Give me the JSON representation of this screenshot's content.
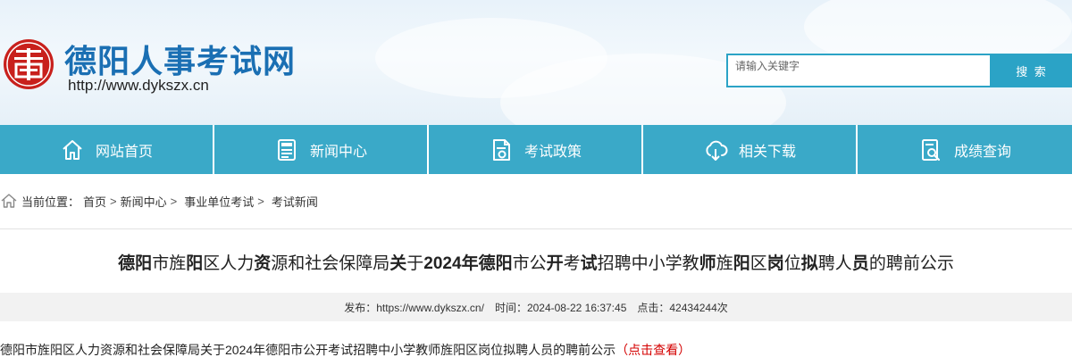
{
  "header": {
    "site_title": "德阳人事考试网",
    "site_url": "http://www.dykszx.cn",
    "logo_icon": "seal-logo-icon",
    "search": {
      "placeholder": "请输入关键字",
      "button_label": "搜 索"
    }
  },
  "nav": {
    "items": [
      {
        "label": "网站首页",
        "icon": "home-icon"
      },
      {
        "label": "新闻中心",
        "icon": "news-icon"
      },
      {
        "label": "考试政策",
        "icon": "document-icon"
      },
      {
        "label": "相关下载",
        "icon": "cloud-download-icon"
      },
      {
        "label": "成绩查询",
        "icon": "search-document-icon"
      }
    ]
  },
  "breadcrumb": {
    "prefix": "当前位置：",
    "items": [
      "首页",
      "新闻中心",
      "事业单位考试",
      "考试新闻"
    ],
    "separator": ">"
  },
  "article": {
    "title_segments": [
      {
        "text": "德阳",
        "bold": true
      },
      {
        "text": "市旌",
        "bold": false
      },
      {
        "text": "阳",
        "bold": true
      },
      {
        "text": "区人力",
        "bold": false
      },
      {
        "text": "资",
        "bold": true
      },
      {
        "text": "源和社会保障局",
        "bold": false
      },
      {
        "text": "关",
        "bold": true
      },
      {
        "text": "于",
        "bold": false
      },
      {
        "text": "2024年",
        "bold": true
      },
      {
        "text": "德阳",
        "bold": true
      },
      {
        "text": "市公",
        "bold": false
      },
      {
        "text": "开",
        "bold": true
      },
      {
        "text": "考",
        "bold": false
      },
      {
        "text": "试",
        "bold": true
      },
      {
        "text": "招聘中小学教",
        "bold": false
      },
      {
        "text": "师",
        "bold": true
      },
      {
        "text": "旌",
        "bold": false
      },
      {
        "text": "阳",
        "bold": true
      },
      {
        "text": "区",
        "bold": false
      },
      {
        "text": "岗",
        "bold": true
      },
      {
        "text": "位",
        "bold": false
      },
      {
        "text": "拟",
        "bold": true
      },
      {
        "text": "聘人",
        "bold": false
      },
      {
        "text": "员",
        "bold": true
      },
      {
        "text": "的聘前公示",
        "bold": false
      }
    ],
    "meta": {
      "publisher": "发布：https://www.dykszx.cn/",
      "time": "时间：2024-08-22 16:37:45",
      "clicks": "点击：42434244次"
    },
    "body_text": "德阳市旌阳区人力资源和社会保障局关于2024年德阳市公开考试招聘中小学教师旌阳区岗位拟聘人员的聘前公示",
    "body_link": "（点击查看）"
  },
  "colors": {
    "brand_blue": "#1a6fb3",
    "nav_bg": "#3aa9c8",
    "search_border": "#2ba3c6",
    "seal_red": "#c8201c",
    "link_red": "#d40000"
  }
}
